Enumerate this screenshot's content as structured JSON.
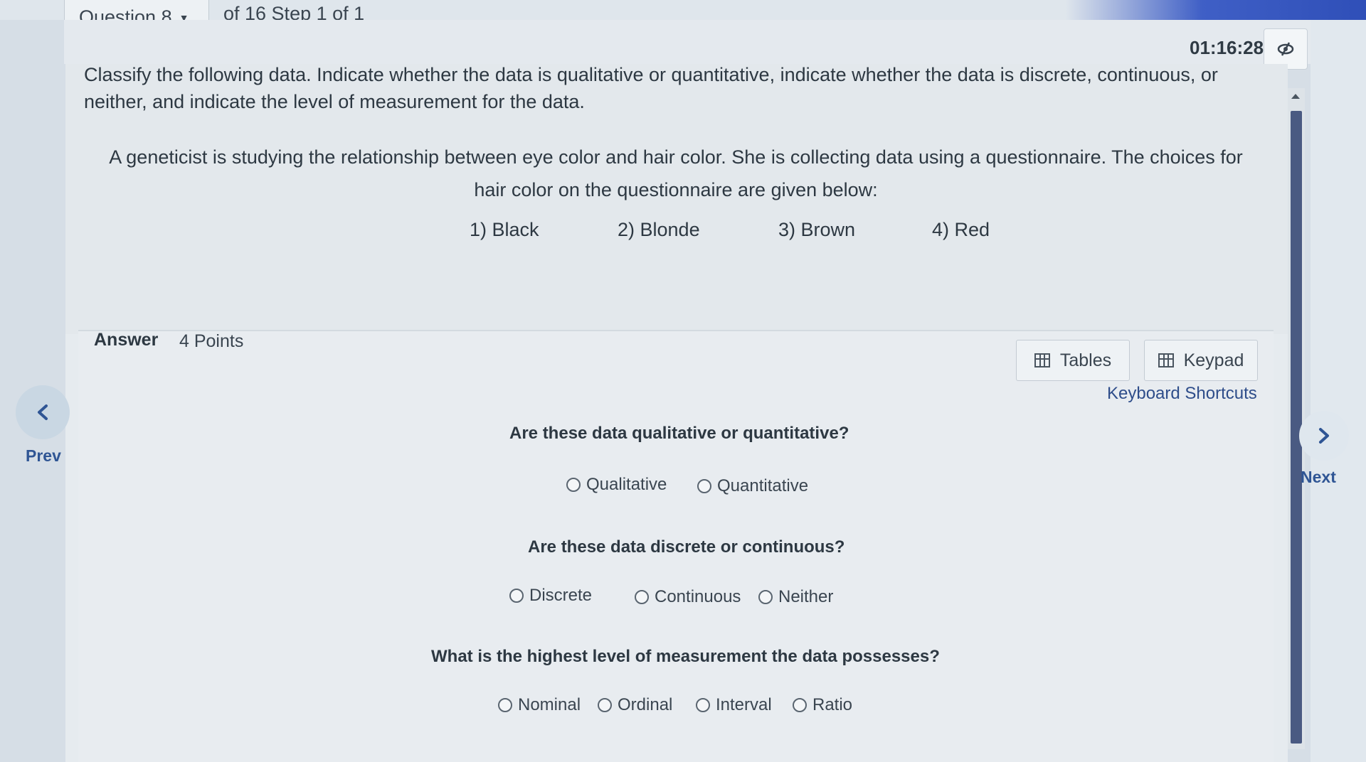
{
  "header": {
    "question_label": "Question 8",
    "step_text": "of 16 Step 1 of 1",
    "timer": "01:16:28"
  },
  "question": {
    "instruction": "Classify the following data. Indicate whether the data is qualitative or quantitative, indicate whether the data is discrete, continuous, or neither, and indicate the level of measurement for the data.",
    "scenario": "A geneticist is studying the relationship between eye color and hair color. She is collecting data using a questionnaire. The choices for hair color on the questionnaire are given below:",
    "choices": [
      "1) Black",
      "2) Blonde",
      "3) Brown",
      "4) Red"
    ]
  },
  "answer": {
    "label": "Answer",
    "points": "4 Points",
    "tables_label": "Tables",
    "keypad_label": "Keypad",
    "shortcuts_label": "Keyboard Shortcuts",
    "q1": {
      "prompt": "Are these data qualitative or quantitative?",
      "options": [
        "Qualitative",
        "Quantitative"
      ]
    },
    "q2": {
      "prompt": "Are these data discrete or continuous?",
      "options": [
        "Discrete",
        "Continuous",
        "Neither"
      ]
    },
    "q3": {
      "prompt": "What is the highest level of measurement the data possesses?",
      "options": [
        "Nominal",
        "Ordinal",
        "Interval",
        "Ratio"
      ]
    }
  },
  "nav": {
    "prev_label": "Prev",
    "next_label": "Next"
  },
  "icons": {
    "hide_timer": "eye-slash-icon",
    "prev": "chevron-left-icon",
    "next": "chevron-right-icon",
    "tables": "table-icon",
    "keypad": "keypad-icon"
  }
}
